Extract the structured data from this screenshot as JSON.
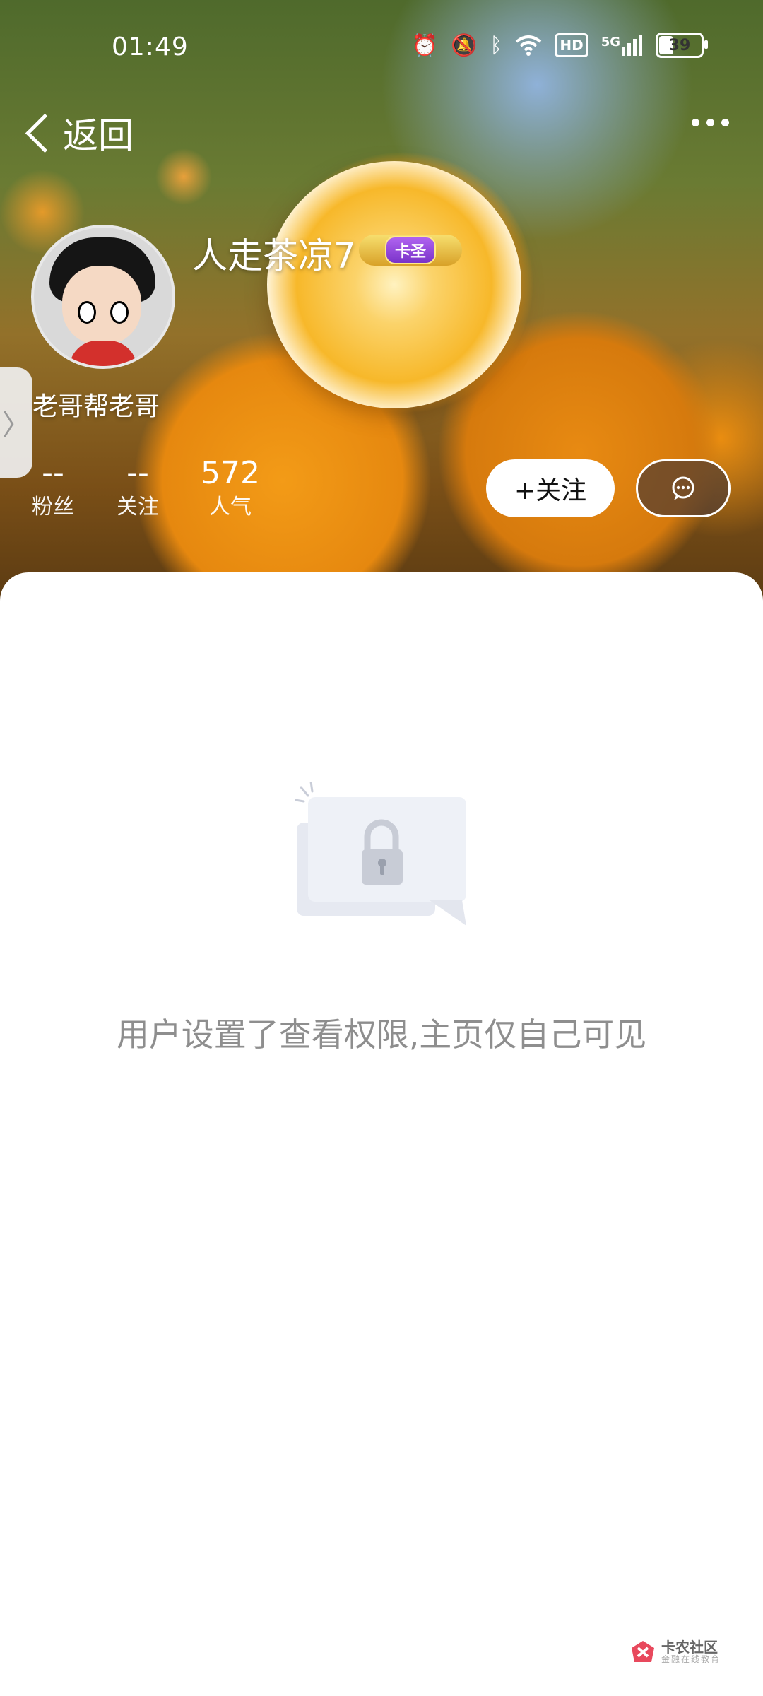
{
  "status_bar": {
    "time": "01:49",
    "icons": [
      "alarm-icon",
      "mute-icon",
      "bluetooth-icon",
      "wifi-icon",
      "hd-icon",
      "signal-5g-icon",
      "battery-icon"
    ],
    "hd_label": "HD",
    "network_label": "5G",
    "battery": "39"
  },
  "nav": {
    "back_label": "返回",
    "more_icon": "more-dots-icon"
  },
  "profile": {
    "username": "人走茶凉7",
    "level_badge": "卡圣",
    "bio": "老哥帮老哥",
    "stats": [
      {
        "value": "--",
        "label": "粉丝"
      },
      {
        "value": "--",
        "label": "关注"
      },
      {
        "value": "572",
        "label": "人气"
      }
    ],
    "follow_button": "+关注",
    "message_icon": "chat-bubble-icon"
  },
  "side_tab": {
    "glyph": "〉"
  },
  "content": {
    "private_message": "用户设置了查看权限,主页仅自己可见",
    "illustration_icon": "lock-icon"
  },
  "watermark": {
    "title": "卡农社区",
    "subtitle": "金融在线教育"
  },
  "colors": {
    "header_orange": "#f4a11a",
    "text_muted": "#8e8e8e",
    "card_bg": "#ffffff"
  }
}
